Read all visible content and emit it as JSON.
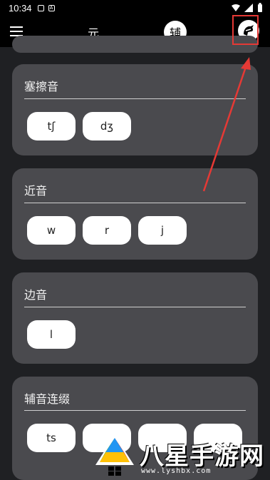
{
  "status_bar": {
    "time": "10:34",
    "notif_badge": "A"
  },
  "app_bar": {
    "vowel_tab": "元",
    "consonant_tab": "辅"
  },
  "cards": [
    {
      "title": "塞擦音",
      "chips": [
        "tʃ",
        "dʒ"
      ]
    },
    {
      "title": "近音",
      "chips": [
        "w",
        "r",
        "j"
      ]
    },
    {
      "title": "边音",
      "chips": [
        "l"
      ]
    },
    {
      "title": "辅音连缀",
      "chips": [
        "ts",
        "",
        "",
        ""
      ]
    }
  ],
  "watermark": {
    "brand": "八星手游网",
    "url": "www.lyshbx.com"
  },
  "colors": {
    "highlight": "#e53935",
    "card": "#4a4a4e",
    "background": "#1f2023"
  }
}
